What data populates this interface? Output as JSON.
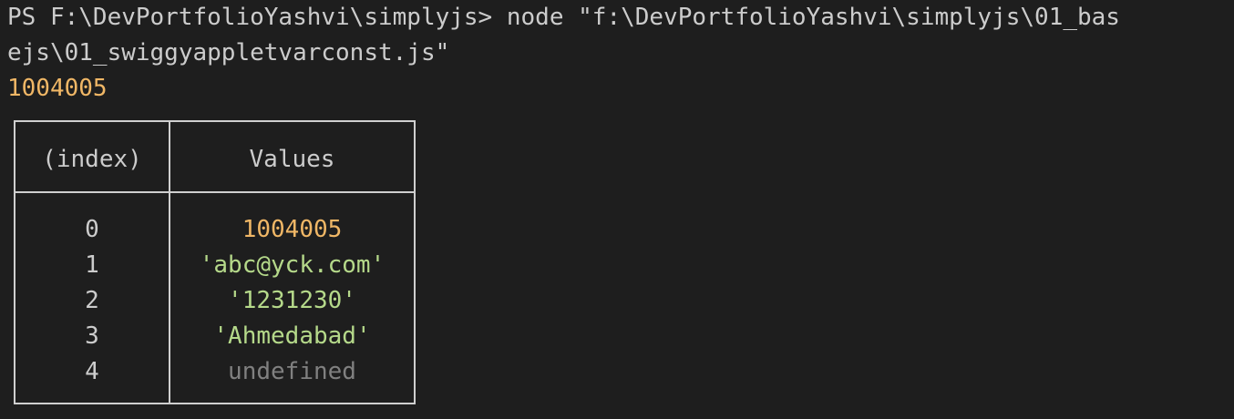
{
  "terminal": {
    "prompt_line_1": "PS F:\\DevPortfolioYashvi\\simplyjs> node \"f:\\DevPortfolioYashvi\\simplyjs\\01_bas",
    "prompt_line_2": "ejs\\01_swiggyappletvarconst.js\"",
    "output_value": "1004005"
  },
  "table": {
    "headers": [
      "(index)",
      "Values"
    ],
    "rows": [
      {
        "index": "0",
        "value": "1004005",
        "kind": "number"
      },
      {
        "index": "1",
        "value": "'abc@yck.com'",
        "kind": "string"
      },
      {
        "index": "2",
        "value": "'1231230'",
        "kind": "string"
      },
      {
        "index": "3",
        "value": "'Ahmedabad'",
        "kind": "string"
      },
      {
        "index": "4",
        "value": "undefined",
        "kind": "undefined"
      }
    ]
  },
  "colors": {
    "background": "#1e1e1e",
    "text": "#cccccc",
    "number": "#f0b766",
    "string": "#b5d98a",
    "undefined": "#808080",
    "table_border": "#cfcfcf"
  }
}
